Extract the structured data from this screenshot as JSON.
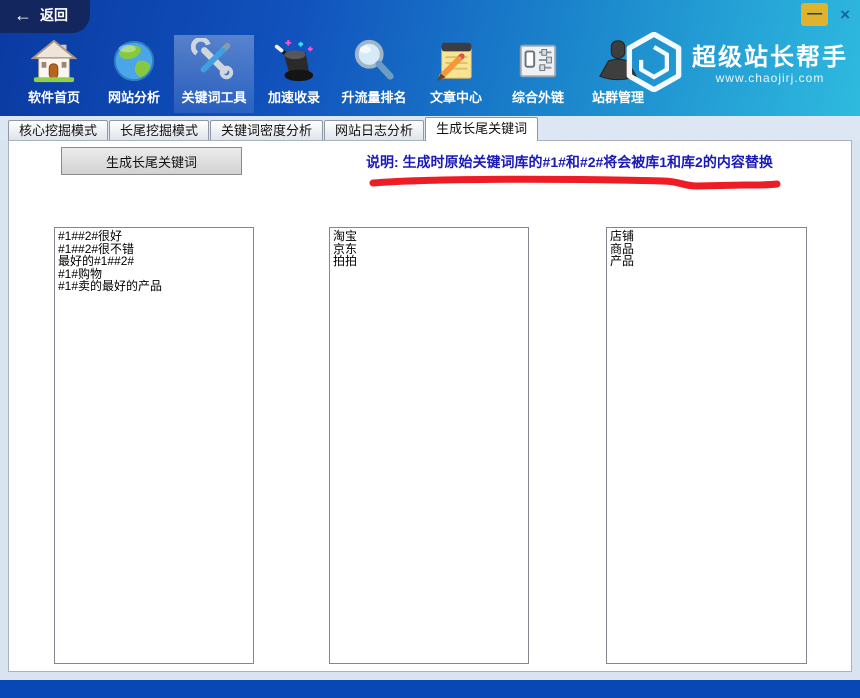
{
  "window": {
    "back_arrow": "←",
    "back_label": "返回",
    "controls": {
      "minimize": "—",
      "close": "×"
    }
  },
  "brand": {
    "name": "超级站长帮手",
    "url": "www.chaojirj.com"
  },
  "nav": {
    "selected": "关键词工具",
    "items": [
      {
        "label": "软件首页",
        "icon": "home-icon"
      },
      {
        "label": "网站分析",
        "icon": "globe-icon"
      },
      {
        "label": "关键词工具",
        "icon": "tools-icon"
      },
      {
        "label": "加速收录",
        "icon": "magic-hat-icon"
      },
      {
        "label": "升流量排名",
        "icon": "magnifier-icon"
      },
      {
        "label": "文章中心",
        "icon": "article-icon"
      },
      {
        "label": "综合外链",
        "icon": "sliders-icon"
      },
      {
        "label": "站群管理",
        "icon": "user-icon"
      }
    ]
  },
  "tabs": {
    "active": "生成长尾关键词",
    "items": [
      {
        "label": "核心挖掘模式"
      },
      {
        "label": "长尾挖掘模式"
      },
      {
        "label": "关键词密度分析"
      },
      {
        "label": "网站日志分析"
      },
      {
        "label": "生成长尾关键词"
      }
    ]
  },
  "main": {
    "generate_button": "生成长尾关键词",
    "note": "说明: 生成时原始关键词库的#1#和#2#将会被库1和库2的内容替换",
    "lists": [
      "#1##2#很好\n#1##2#很不错\n最好的#1##2#\n#1#购物\n#1#卖的最好的产品",
      "淘宝\n京东\n拍拍",
      "店铺\n商品\n产品"
    ]
  },
  "colors": {
    "header_left": "#0a3aa2",
    "header_right": "#2ebadf",
    "note_text": "#1a1ab8",
    "underline_red": "#ee1c24",
    "bottom_bar": "#0747b6",
    "minimize_bg": "#dfb32d"
  }
}
